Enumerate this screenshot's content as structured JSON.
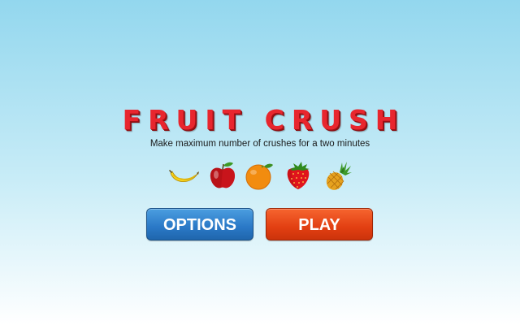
{
  "game": {
    "title": "FRUIT CRUSH",
    "subtitle": "Make maximum number of crushes for a two minutes"
  },
  "fruits": [
    {
      "icon": "banana-icon"
    },
    {
      "icon": "apple-icon"
    },
    {
      "icon": "orange-icon"
    },
    {
      "icon": "strawberry-icon"
    },
    {
      "icon": "pineapple-icon"
    }
  ],
  "buttons": {
    "options_label": "OPTIONS",
    "play_label": "PLAY"
  },
  "colors": {
    "title": "#e8262e",
    "options_button": "#2a78c6",
    "play_button": "#e23f12",
    "background_top": "#93d7ee",
    "background_bottom": "#ffffff"
  }
}
